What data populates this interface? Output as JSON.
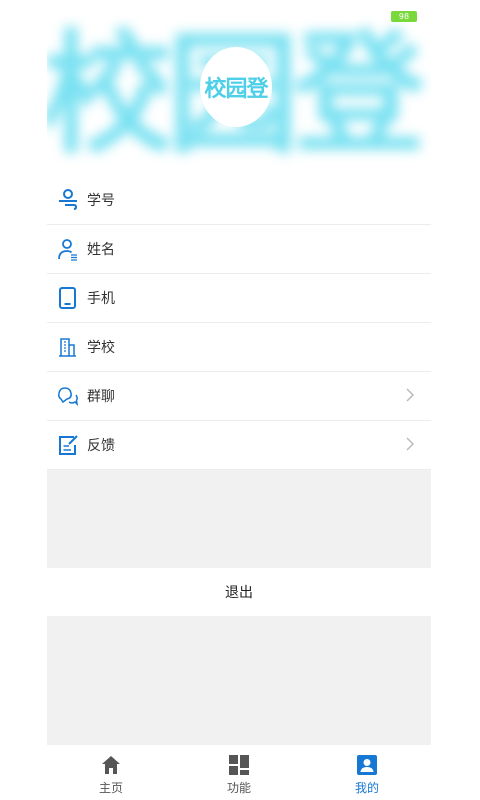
{
  "status": {
    "battery": "98"
  },
  "header": {
    "background_text": "校园登",
    "logo_text": "校园登"
  },
  "menu": {
    "items": [
      {
        "icon": "student-id-icon",
        "label": "学号"
      },
      {
        "icon": "person-icon",
        "label": "姓名"
      },
      {
        "icon": "phone-icon",
        "label": "手机"
      },
      {
        "icon": "building-icon",
        "label": "学校"
      },
      {
        "icon": "group-chat-icon",
        "label": "群聊"
      },
      {
        "icon": "feedback-icon",
        "label": "反馈"
      }
    ]
  },
  "logout_label": "退出",
  "tabs": [
    {
      "icon": "home-icon",
      "label": "主页"
    },
    {
      "icon": "grid-icon",
      "label": "功能"
    },
    {
      "icon": "profile-icon",
      "label": "我的"
    }
  ],
  "colors": {
    "accent": "#1678d2",
    "brand": "#4dcfe8",
    "battery": "#79d93b"
  }
}
